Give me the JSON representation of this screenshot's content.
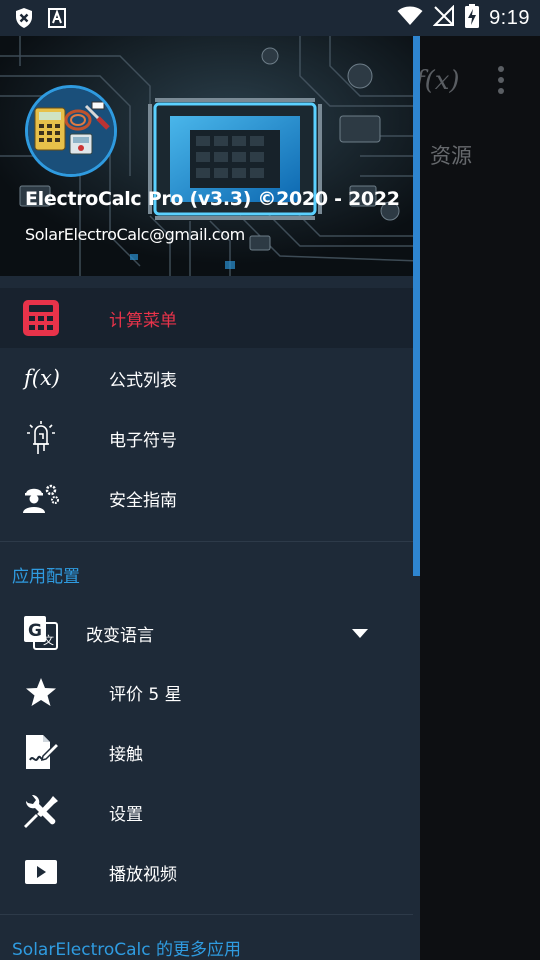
{
  "status_bar": {
    "time": "9:19",
    "left_icons": [
      "shield-x-icon",
      "a-text-icon"
    ],
    "right_icons": [
      "wifi-icon",
      "no-signal-icon",
      "battery-charging-icon"
    ]
  },
  "background_app": {
    "fx_label": "f(x)",
    "resource_label": "资源"
  },
  "drawer": {
    "header": {
      "title": "ElectroCalc Pro (v3.3) ©2020 - 2022",
      "email": "SolarElectroCalc@gmail.com"
    },
    "main_items": [
      {
        "label": "计算菜单",
        "icon": "calculator-icon",
        "active": true
      },
      {
        "label": "公式列表",
        "icon": "fx-icon"
      },
      {
        "label": "电子符号",
        "icon": "led-icon"
      },
      {
        "label": "安全指南",
        "icon": "worker-safety-icon"
      }
    ],
    "config_section": {
      "title": "应用配置",
      "items": [
        {
          "label": "改变语言",
          "icon": "translate-icon"
        },
        {
          "label": "评价 5 星",
          "icon": "star-icon"
        },
        {
          "label": "接触",
          "icon": "contact-sign-icon"
        },
        {
          "label": "设置",
          "icon": "wrench-screwdriver-icon"
        },
        {
          "label": "播放视频",
          "icon": "play-video-icon"
        }
      ]
    },
    "more_apps_label": "SolarElectroCalc 的更多应用"
  },
  "colors": {
    "drawer_bg": "#1e2a38",
    "accent_blue": "#2f9be0",
    "active_red": "#e8334a"
  }
}
